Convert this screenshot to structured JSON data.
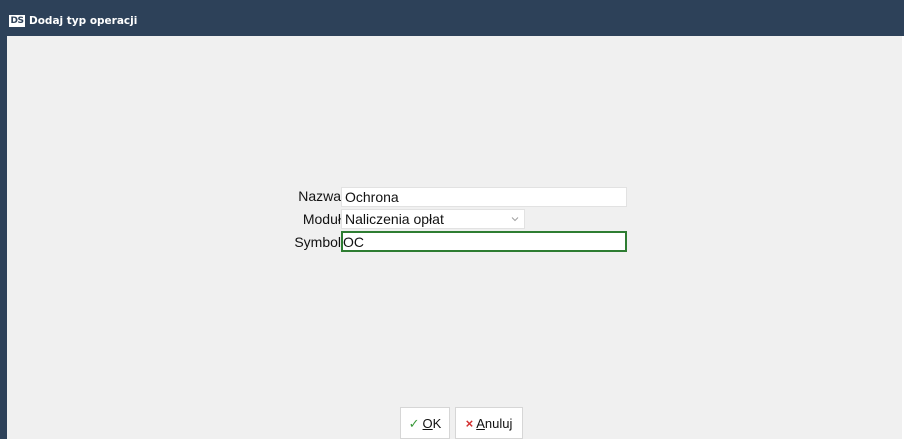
{
  "window": {
    "icon_text": "DS",
    "title": "Dodaj typ operacji"
  },
  "form": {
    "nazwa": {
      "label": "Nazwa",
      "value": "Ochrona"
    },
    "modul": {
      "label": "Moduł",
      "value": "Naliczenia opłat"
    },
    "symbol": {
      "label": "Symbol",
      "value": "OC"
    }
  },
  "buttons": {
    "ok": {
      "icon": "checkmark-icon",
      "mnemonic": "O",
      "rest": "K"
    },
    "cancel": {
      "icon": "x-icon",
      "mnemonic": "A",
      "rest": "nuluj"
    }
  },
  "colors": {
    "titlebar": "#2d4159",
    "background": "#f0f0f0",
    "focus_border": "#2e7d32",
    "ok_icon": "#3a9a3a",
    "cancel_icon": "#d32f2f"
  }
}
